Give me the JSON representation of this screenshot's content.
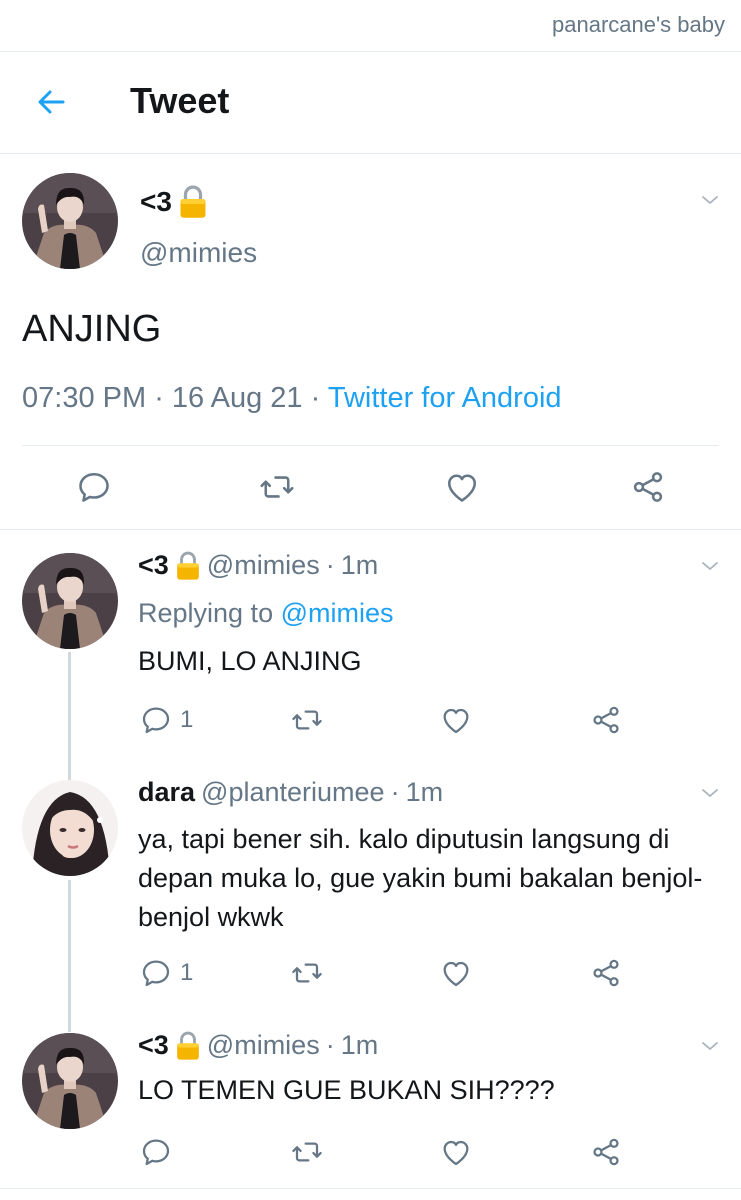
{
  "watermark": "panarcane's baby",
  "header": {
    "title": "Tweet"
  },
  "main_tweet": {
    "name": "<3",
    "handle": "@mimies",
    "text": "ANJING",
    "time": "07:30 PM",
    "date": "16 Aug 21",
    "source": "Twitter for Android"
  },
  "replies": [
    {
      "name": "<3",
      "handle": "@mimies",
      "age": "1m",
      "replying_label": "Replying to",
      "replying_to": "@mimies",
      "text": "BUMI, LO ANJING",
      "reply_count": "1"
    },
    {
      "name": "dara",
      "handle": "@planteriumee",
      "age": "1m",
      "text": "ya, tapi bener sih. kalo diputusin langsung di depan muka lo, gue yakin bumi bakalan benjol-benjol wkwk",
      "reply_count": "1"
    },
    {
      "name": "<3",
      "handle": "@mimies",
      "age": "1m",
      "text": "LO TEMEN GUE BUKAN SIH????"
    }
  ],
  "icons": {
    "back": "arrow-left-icon",
    "lock": "lock-icon",
    "more": "chevron-down-icon",
    "reply": "reply-icon",
    "retweet": "retweet-icon",
    "like": "heart-icon",
    "share": "share-icon"
  },
  "colors": {
    "accent": "#1da1f2",
    "secondary_text": "#657786",
    "lock_gold": "#f5b400",
    "divider": "#e6ecf0"
  }
}
